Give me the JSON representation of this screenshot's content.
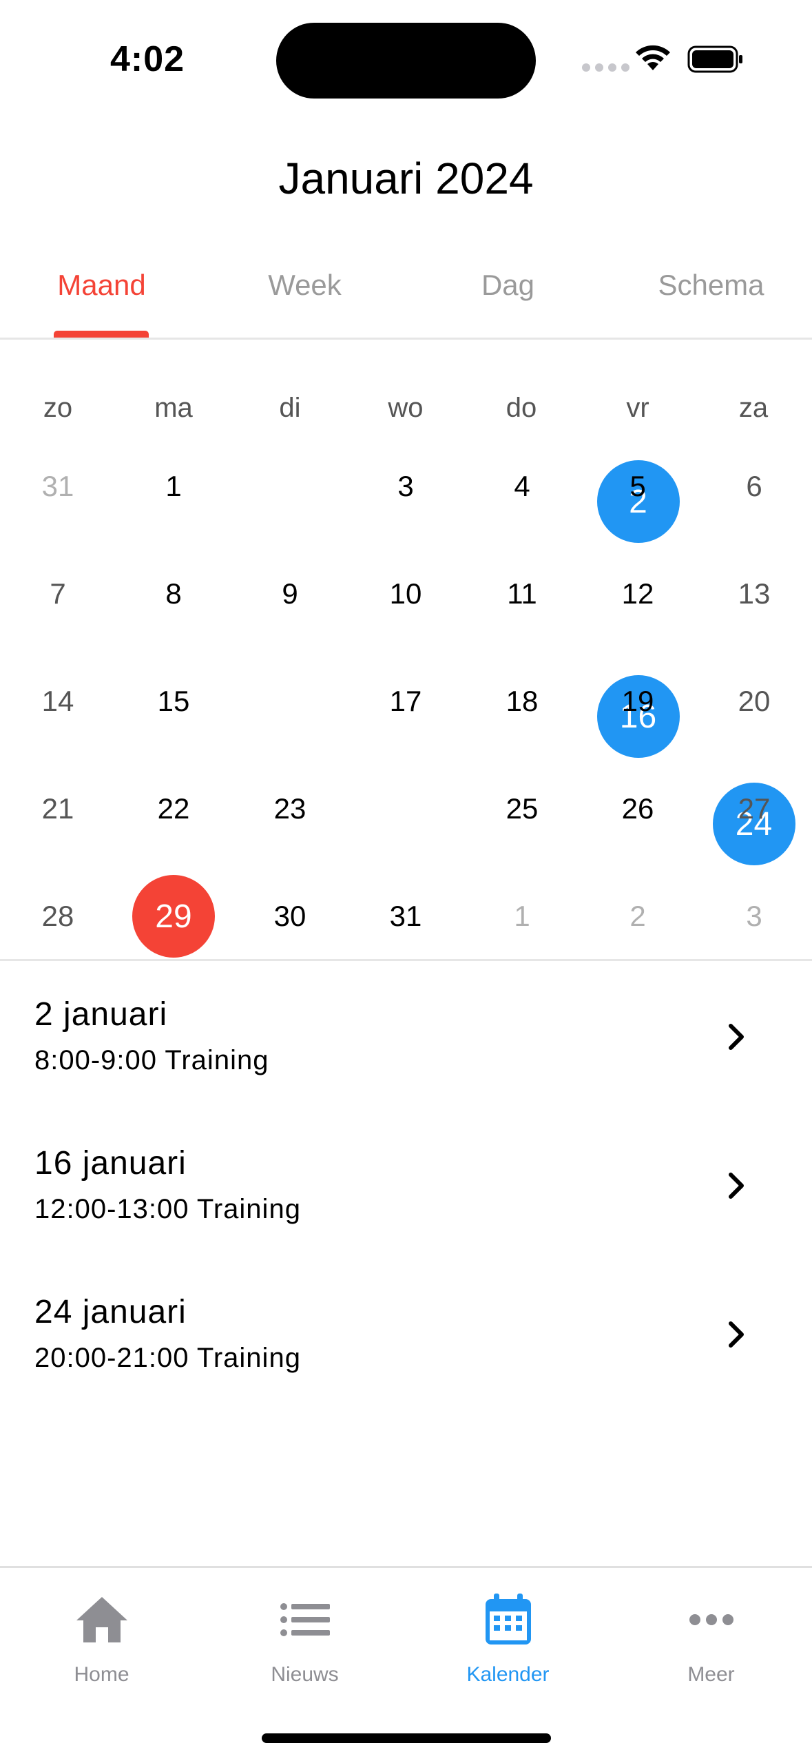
{
  "status_bar": {
    "time": "4:02"
  },
  "header": {
    "title": "Januari 2024"
  },
  "tabs": [
    {
      "label": "Maand",
      "active": true
    },
    {
      "label": "Week",
      "active": false
    },
    {
      "label": "Dag",
      "active": false
    },
    {
      "label": "Schema",
      "active": false
    }
  ],
  "calendar": {
    "weekdays": [
      "zo",
      "ma",
      "di",
      "wo",
      "do",
      "vr",
      "za"
    ],
    "weeks": [
      [
        {
          "d": "31",
          "s": "other"
        },
        {
          "d": "1"
        },
        {
          "d": "2",
          "s": "event"
        },
        {
          "d": "3"
        },
        {
          "d": "4"
        },
        {
          "d": "5"
        },
        {
          "d": "6"
        }
      ],
      [
        {
          "d": "7"
        },
        {
          "d": "8"
        },
        {
          "d": "9"
        },
        {
          "d": "10"
        },
        {
          "d": "11"
        },
        {
          "d": "12"
        },
        {
          "d": "13"
        }
      ],
      [
        {
          "d": "14"
        },
        {
          "d": "15"
        },
        {
          "d": "16",
          "s": "event"
        },
        {
          "d": "17"
        },
        {
          "d": "18"
        },
        {
          "d": "19"
        },
        {
          "d": "20"
        }
      ],
      [
        {
          "d": "21"
        },
        {
          "d": "22"
        },
        {
          "d": "23"
        },
        {
          "d": "24",
          "s": "event"
        },
        {
          "d": "25"
        },
        {
          "d": "26"
        },
        {
          "d": "27"
        }
      ],
      [
        {
          "d": "28"
        },
        {
          "d": "29",
          "s": "today"
        },
        {
          "d": "30"
        },
        {
          "d": "31"
        },
        {
          "d": "1",
          "s": "other"
        },
        {
          "d": "2",
          "s": "other"
        },
        {
          "d": "3",
          "s": "other"
        }
      ]
    ],
    "event_color": "#2196f3",
    "today_color": "#f44336"
  },
  "events": [
    {
      "date": "2 januari",
      "detail": "8:00-9:00 Training"
    },
    {
      "date": "16 januari",
      "detail": "12:00-13:00 Training"
    },
    {
      "date": "24 januari",
      "detail": "20:00-21:00 Training"
    }
  ],
  "tabbar": [
    {
      "label": "Home",
      "icon": "home-icon",
      "active": false
    },
    {
      "label": "Nieuws",
      "icon": "list-icon",
      "active": false
    },
    {
      "label": "Kalender",
      "icon": "calendar-icon",
      "active": true
    },
    {
      "label": "Meer",
      "icon": "more-icon",
      "active": false
    }
  ],
  "colors": {
    "accent": "#f44336",
    "primary": "#2196f3",
    "inactive": "#8e8e93"
  }
}
